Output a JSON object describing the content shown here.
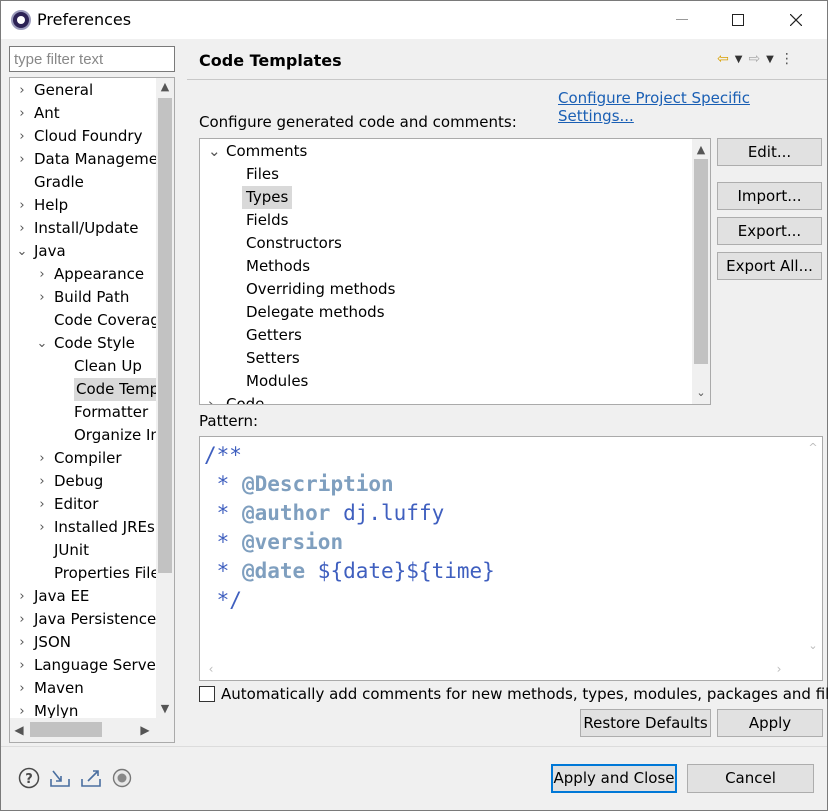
{
  "window": {
    "title": "Preferences",
    "minimize_icon": "minimize-icon",
    "maximize_icon": "maximize-icon",
    "close_icon": "close-icon"
  },
  "filter": {
    "placeholder": "type filter text"
  },
  "nav_tree": {
    "items": [
      {
        "label": "General",
        "expander": "collapsed"
      },
      {
        "label": "Ant",
        "expander": "collapsed"
      },
      {
        "label": "Cloud Foundry",
        "expander": "collapsed"
      },
      {
        "label": "Data Manageme",
        "expander": "collapsed"
      },
      {
        "label": "Gradle",
        "expander": "none"
      },
      {
        "label": "Help",
        "expander": "collapsed"
      },
      {
        "label": "Install/Update",
        "expander": "collapsed"
      },
      {
        "label": "Java",
        "expander": "expanded"
      },
      {
        "label": "Appearance",
        "expander": "collapsed"
      },
      {
        "label": "Build Path",
        "expander": "collapsed"
      },
      {
        "label": "Code Coverag",
        "expander": "none"
      },
      {
        "label": "Code Style",
        "expander": "expanded"
      },
      {
        "label": "Clean Up",
        "expander": "none"
      },
      {
        "label": "Code Temp",
        "expander": "none",
        "selected": true
      },
      {
        "label": "Formatter",
        "expander": "none"
      },
      {
        "label": "Organize In",
        "expander": "none"
      },
      {
        "label": "Compiler",
        "expander": "collapsed"
      },
      {
        "label": "Debug",
        "expander": "collapsed"
      },
      {
        "label": "Editor",
        "expander": "collapsed"
      },
      {
        "label": "Installed JREs",
        "expander": "collapsed"
      },
      {
        "label": "JUnit",
        "expander": "none"
      },
      {
        "label": "Properties File",
        "expander": "none"
      },
      {
        "label": "Java EE",
        "expander": "collapsed"
      },
      {
        "label": "Java Persistence",
        "expander": "collapsed"
      },
      {
        "label": "JSON",
        "expander": "collapsed"
      },
      {
        "label": "Language Server",
        "expander": "collapsed"
      },
      {
        "label": "Maven",
        "expander": "collapsed"
      },
      {
        "label": "Mylyn",
        "expander": "collapsed"
      }
    ]
  },
  "page": {
    "title": "Code Templates",
    "nav": {
      "back_icon": "back-arrow-icon",
      "forward_icon": "forward-arrow-icon",
      "menu_icon": "more-icon"
    },
    "configure_link": "Configure Project Specific Settings...",
    "description": "Configure generated code and comments:",
    "templates": [
      {
        "label": "Comments",
        "expander": "expanded"
      },
      {
        "label": "Files"
      },
      {
        "label": "Types",
        "selected": true
      },
      {
        "label": "Fields"
      },
      {
        "label": "Constructors"
      },
      {
        "label": "Methods"
      },
      {
        "label": "Overriding methods"
      },
      {
        "label": "Delegate methods"
      },
      {
        "label": "Getters"
      },
      {
        "label": "Setters"
      },
      {
        "label": "Modules"
      },
      {
        "label": "Code",
        "expander": "collapsed"
      }
    ],
    "buttons": {
      "edit": "Edit...",
      "import": "Import...",
      "export": "Export...",
      "export_all": "Export All..."
    },
    "pattern_label": "Pattern:",
    "pattern_lines": [
      {
        "prefix": "/**",
        "tag": "",
        "rest": ""
      },
      {
        "prefix": " * ",
        "tag": "@Description",
        "rest": ""
      },
      {
        "prefix": " * ",
        "tag": "@author",
        "rest": " dj.luffy"
      },
      {
        "prefix": " * ",
        "tag": "@version",
        "rest": ""
      },
      {
        "prefix": " * ",
        "tag": "@date",
        "rest": " ${date}${time}"
      },
      {
        "prefix": " */",
        "tag": "",
        "rest": ""
      }
    ],
    "auto_comment_label": "Automatically add comments for new methods, types, modules, packages and files",
    "auto_comment_checked": false,
    "restore_defaults": "Restore Defaults",
    "apply": "Apply"
  },
  "footer": {
    "help_icon": "help-icon",
    "import_icon": "import-icon",
    "export_icon": "export-icon",
    "record_icon": "oomph-icon",
    "apply_close": "Apply and Close",
    "cancel": "Cancel"
  }
}
